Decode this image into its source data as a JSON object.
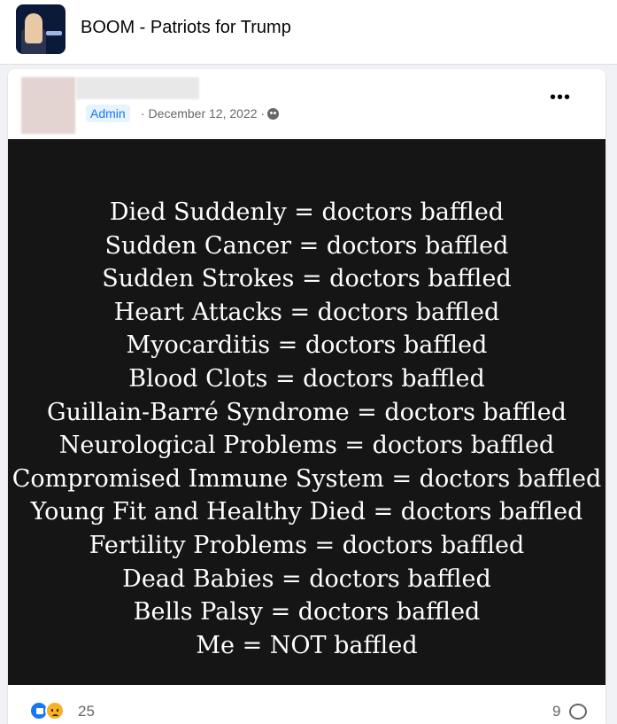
{
  "group": {
    "name": "BOOM - Patriots for Trump"
  },
  "post": {
    "badge": "Admin",
    "meta": "· December 12, 2022 ·",
    "image_lines": [
      "Died Suddenly = doctors baffled",
      "Sudden Cancer = doctors baffled",
      "Sudden Strokes = doctors baffled",
      "Heart Attacks = doctors baffled",
      "Myocarditis = doctors baffled",
      "Blood Clots = doctors baffled",
      "Guillain-Barré Syndrome = doctors baffled",
      "Neurological Problems = doctors baffled",
      "Compromised Immune System = doctors baffled",
      "Young Fit and Healthy Died = doctors baffled",
      "Fertility Problems = doctors baffled",
      "Dead Babies = doctors baffled",
      "Bells Palsy = doctors baffled",
      "Me = NOT baffled"
    ],
    "more_label": "•••",
    "reaction_count": "25",
    "comment_count": "9"
  },
  "colors": {
    "accent": "#1877f2",
    "image_bg": "#151515",
    "page_bg": "#f0f2f5"
  }
}
